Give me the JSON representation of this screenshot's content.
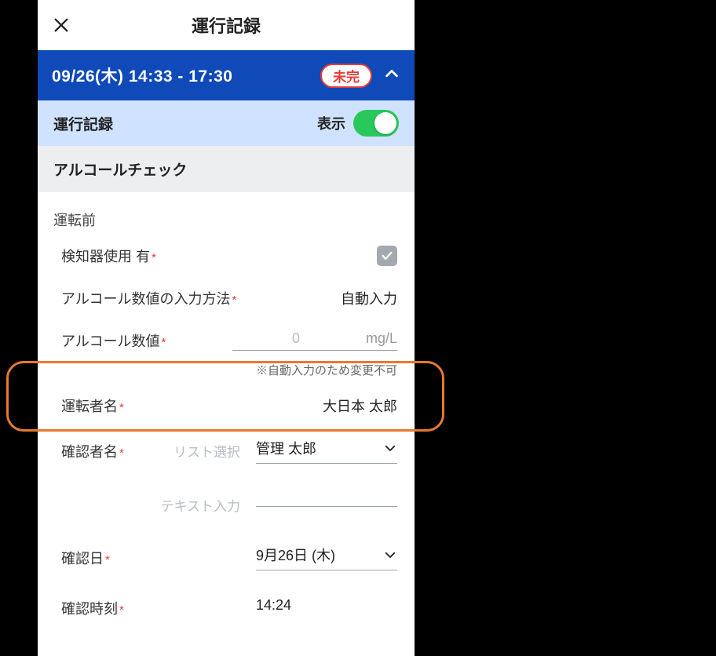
{
  "header": {
    "title": "運行記録"
  },
  "date_bar": {
    "datetime": "09/26(木) 14:33 - 17:30",
    "status": "未完"
  },
  "toggle_section": {
    "left_label": "運行記録",
    "right_label": "表示"
  },
  "alcohol_section": {
    "title": "アルコールチェック",
    "phase": "運転前",
    "rows": {
      "detector": {
        "label": "検知器使用 有"
      },
      "input_method": {
        "label": "アルコール数値の入力方法",
        "value": "自動入力"
      },
      "value_row": {
        "label": "アルコール数値",
        "value": "0",
        "unit": "mg/L",
        "note": "※自動入力のため変更不可"
      },
      "driver": {
        "label": "運転者名",
        "value": "大日本 太郎"
      },
      "confirmer": {
        "label": "確認者名",
        "placeholder": "リスト選択",
        "value": "管理 太郎"
      },
      "text_input": {
        "placeholder": "テキスト入力"
      },
      "confirm_date": {
        "label": "確認日",
        "value": "9月26日 (木)"
      },
      "confirm_time": {
        "label": "確認時刻",
        "value": "14:24"
      }
    }
  }
}
